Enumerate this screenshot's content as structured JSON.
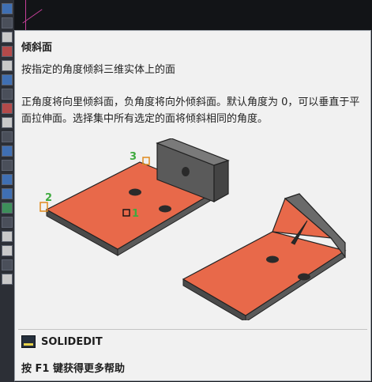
{
  "tooltip": {
    "title": "倾斜面",
    "description": "按指定的角度倾斜三维实体上的面",
    "body": "正角度将向里倾斜面，负角度将向外倾斜面。默认角度为 0，可以垂直于平面拉伸面。选择集中所有选定的面将倾斜相同的角度。",
    "command": {
      "icon": "command-line-icon",
      "name": "SOLIDEDIT"
    },
    "help": "按 F1 键获得更多帮助"
  },
  "illustration": {
    "step_labels": [
      "3",
      "2",
      "1"
    ],
    "colors": {
      "face": "#e8694a",
      "body": "#555555",
      "label": "#3faa3f",
      "marker": "#e08a1e"
    }
  }
}
